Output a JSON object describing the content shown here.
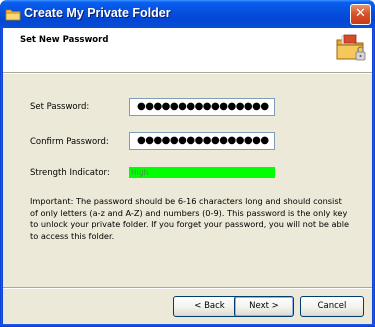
{
  "window": {
    "title": "Create My Private Folder",
    "close_symbol": "✕"
  },
  "header": {
    "title": "Set New Password",
    "icon": "folder-lock-icon"
  },
  "form": {
    "set_password_label": "Set Password:",
    "set_password_value": "●●●●●●●●●●●●●●●●",
    "confirm_password_label": "Confirm Password:",
    "confirm_password_value": "●●●●●●●●●●●●●●●●",
    "strength_label": "Strength Indicator:",
    "strength_value": "High",
    "strength_color": "#00ff00"
  },
  "note": "Important: The password should be 6-16 characters long and should consist of only letters (a-z and A-Z) and numbers (0-9). This password is the only key to unlock your private folder. If you forget your password, you will not be able to access this folder.",
  "buttons": {
    "back": "< Back",
    "next": "Next >",
    "cancel": "Cancel"
  }
}
